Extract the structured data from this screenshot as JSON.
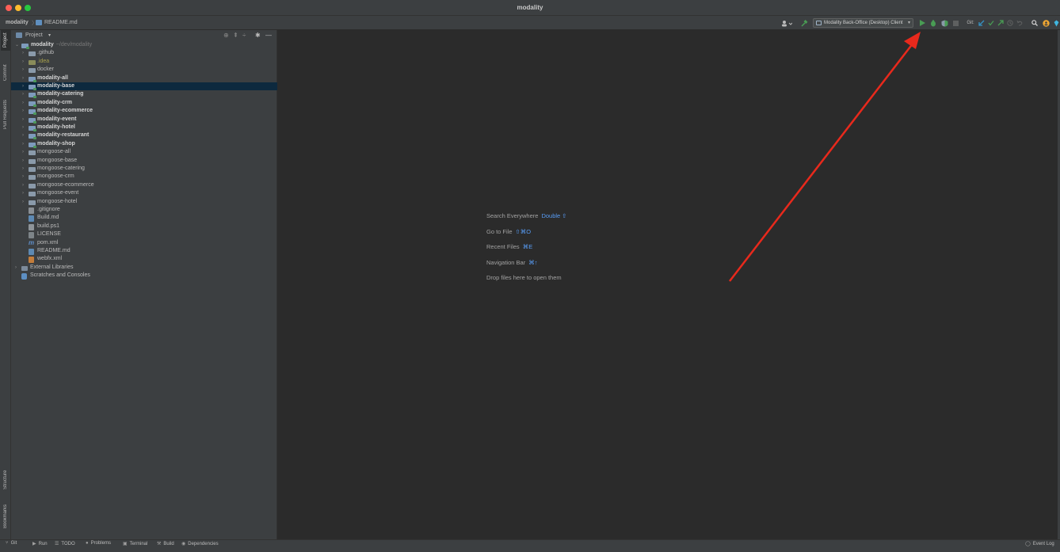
{
  "window": {
    "title": "modality"
  },
  "breadcrumb": {
    "project": "modality",
    "file": "README.md"
  },
  "toolbar": {
    "user_icon": "user-icon",
    "build_icon": "hammer-icon",
    "run_config_label": "Modality Back-Office (Desktop) Client",
    "run_icon": "play-icon",
    "debug_icon": "bug-icon",
    "coverage_icon": "coverage-icon",
    "stop_icon": "stop-icon",
    "git_label": "Git:",
    "search_icon": "magnifier-icon",
    "colors": {
      "run": "#499c54",
      "git_update": "#3592c4",
      "git_commit": "#499c54",
      "git_push": "#499c54",
      "notify": "#f0a732"
    }
  },
  "left_tabs": [
    "Project",
    "Commit",
    "Pull Requests",
    "Structure",
    "Bookmarks"
  ],
  "project_panel": {
    "title": "Project",
    "root": {
      "name": "modality",
      "path": "~/dev/modality"
    },
    "items": [
      {
        "label": ".github",
        "kind": "folder",
        "expandable": true,
        "bold": false
      },
      {
        "label": ".idea",
        "kind": "idea-folder",
        "expandable": true,
        "bold": false
      },
      {
        "label": "docker",
        "kind": "folder",
        "expandable": true,
        "bold": false
      },
      {
        "label": "modality-all",
        "kind": "module",
        "expandable": true,
        "bold": true
      },
      {
        "label": "modality-base",
        "kind": "module",
        "expandable": true,
        "bold": true,
        "selected": true
      },
      {
        "label": "modality-catering",
        "kind": "module",
        "expandable": true,
        "bold": true
      },
      {
        "label": "modality-crm",
        "kind": "module",
        "expandable": true,
        "bold": true
      },
      {
        "label": "modality-ecommerce",
        "kind": "module",
        "expandable": true,
        "bold": true
      },
      {
        "label": "modality-event",
        "kind": "module",
        "expandable": true,
        "bold": true
      },
      {
        "label": "modality-hotel",
        "kind": "module",
        "expandable": true,
        "bold": true
      },
      {
        "label": "modality-restaurant",
        "kind": "module",
        "expandable": true,
        "bold": true
      },
      {
        "label": "modality-shop",
        "kind": "module",
        "expandable": true,
        "bold": true
      },
      {
        "label": "mongoose-all",
        "kind": "folder",
        "expandable": true,
        "bold": false
      },
      {
        "label": "mongoose-base",
        "kind": "folder",
        "expandable": true,
        "bold": false
      },
      {
        "label": "mongoose-catering",
        "kind": "folder",
        "expandable": true,
        "bold": false
      },
      {
        "label": "mongoose-crm",
        "kind": "folder",
        "expandable": true,
        "bold": false
      },
      {
        "label": "mongoose-ecommerce",
        "kind": "folder",
        "expandable": true,
        "bold": false
      },
      {
        "label": "mongoose-event",
        "kind": "folder",
        "expandable": true,
        "bold": false
      },
      {
        "label": "mongoose-hotel",
        "kind": "folder",
        "expandable": true,
        "bold": false
      },
      {
        "label": ".gitignore",
        "kind": "git-file",
        "expandable": false,
        "bold": false
      },
      {
        "label": "Build.md",
        "kind": "md-file",
        "expandable": false,
        "bold": false
      },
      {
        "label": "build.ps1",
        "kind": "ps-file",
        "expandable": false,
        "bold": false
      },
      {
        "label": "LICENSE",
        "kind": "text-file",
        "expandable": false,
        "bold": false
      },
      {
        "label": "pom.xml",
        "kind": "maven-file",
        "expandable": false,
        "bold": false
      },
      {
        "label": "README.md",
        "kind": "md-file",
        "expandable": false,
        "bold": false
      },
      {
        "label": "webfx.xml",
        "kind": "xml-file",
        "expandable": false,
        "bold": false
      }
    ],
    "external_libraries": "External Libraries",
    "scratches": "Scratches and Consoles"
  },
  "editor_hints": [
    {
      "label": "Search Everywhere",
      "shortcut": "Double ⇧"
    },
    {
      "label": "Go to File",
      "shortcut": "⇧⌘O"
    },
    {
      "label": "Recent Files",
      "shortcut": "⌘E"
    },
    {
      "label": "Navigation Bar",
      "shortcut": "⌘↑"
    },
    {
      "label": "Drop files here to open them",
      "shortcut": ""
    }
  ],
  "bottom_tabs": [
    {
      "label": "Git",
      "icon": "git-icon"
    },
    {
      "label": "Run",
      "icon": "play-icon"
    },
    {
      "label": "TODO",
      "icon": "list-icon"
    },
    {
      "label": "Problems",
      "icon": "problems-icon"
    },
    {
      "label": "Terminal",
      "icon": "terminal-icon"
    },
    {
      "label": "Build",
      "icon": "hammer-icon"
    },
    {
      "label": "Dependencies",
      "icon": "dependencies-icon"
    }
  ],
  "event_log": "Event Log",
  "annotation": {
    "color": "#e8291c"
  }
}
